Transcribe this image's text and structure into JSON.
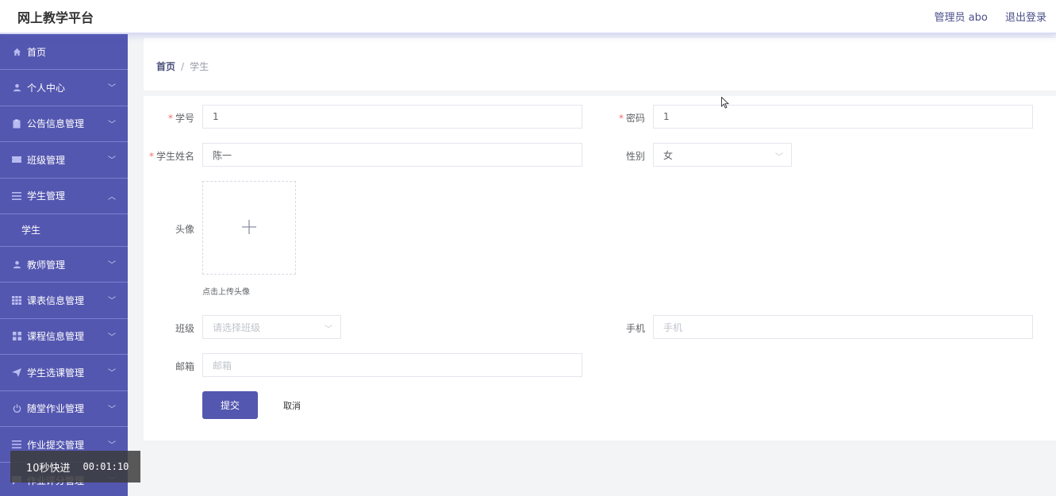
{
  "header": {
    "title": "网上教学平台",
    "user": "管理员 abo",
    "logout": "退出登录"
  },
  "sidebar": {
    "items": [
      {
        "label": "首页",
        "icon": "home-icon"
      },
      {
        "label": "个人中心",
        "icon": "user-icon"
      },
      {
        "label": "公告信息管理",
        "icon": "clipboard-icon"
      },
      {
        "label": "班级管理",
        "icon": "ticket-icon"
      },
      {
        "label": "学生管理",
        "icon": "list-icon",
        "expanded": true,
        "children": [
          {
            "label": "学生"
          }
        ]
      },
      {
        "label": "教师管理",
        "icon": "user-icon"
      },
      {
        "label": "课表信息管理",
        "icon": "grid-icon"
      },
      {
        "label": "课程信息管理",
        "icon": "apps-icon"
      },
      {
        "label": "学生选课管理",
        "icon": "send-icon"
      },
      {
        "label": "随堂作业管理",
        "icon": "power-icon"
      },
      {
        "label": "作业提交管理",
        "icon": "list-icon"
      },
      {
        "label": "作业评分管理",
        "icon": "comment-icon"
      }
    ]
  },
  "breadcrumb": {
    "home": "首页",
    "separator": "/",
    "current": "学生"
  },
  "form": {
    "student_id": {
      "label": "学号",
      "value": "1"
    },
    "password": {
      "label": "密码",
      "value": "1"
    },
    "name": {
      "label": "学生姓名",
      "value": "陈一"
    },
    "gender": {
      "label": "性别",
      "value": "女"
    },
    "avatar": {
      "label": "头像",
      "tip": "点击上传头像"
    },
    "class": {
      "label": "班级",
      "placeholder": "请选择班级"
    },
    "phone": {
      "label": "手机",
      "placeholder": "手机"
    },
    "email": {
      "label": "邮箱",
      "placeholder": "邮箱"
    },
    "submit": "提交",
    "cancel": "取消"
  },
  "overlay": {
    "fast_forward": "10秒快进",
    "time": "00:01:10"
  },
  "colors": {
    "sidebar_bg": "#5457b0",
    "primary": "#5457b0",
    "required": "#f56c6c"
  }
}
